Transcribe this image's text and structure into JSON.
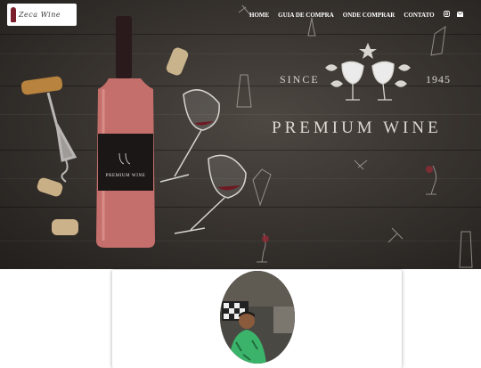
{
  "brand": {
    "logo_text": "Zeca Wine",
    "accent": "#7a1f2b"
  },
  "nav": {
    "items": [
      "HOME",
      "GUIA DE COMPRA",
      "ONDE COMPRAR",
      "CONTATO"
    ],
    "icons": [
      "instagram-icon",
      "email-icon"
    ]
  },
  "hero": {
    "since": "SINCE",
    "year": "1945",
    "headline": "PREMIUM WINE",
    "bottle_label": "PREMIUM WINE"
  },
  "colors": {
    "wood": "#3a3531",
    "wine": "#b8555a",
    "text_light": "#dcd8d2"
  }
}
